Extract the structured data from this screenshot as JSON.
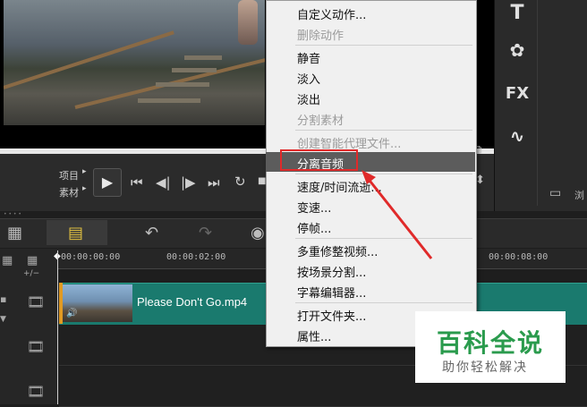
{
  "controls": {
    "project_label": "项目",
    "clip_label": "素材"
  },
  "timeline": {
    "timecodes": [
      "00:00:00:00",
      "00:00:02:00",
      "00:00:08:00"
    ],
    "clip_name": "Please Don't Go.mp4",
    "scale_toggle": "+/−"
  },
  "right_panel": {
    "fx_label": "FX",
    "browse_label": "浏"
  },
  "context_menu": {
    "items": [
      {
        "label": "自定义动作...",
        "enabled": true
      },
      {
        "label": "删除动作",
        "enabled": false
      },
      {
        "label": "静音",
        "enabled": true
      },
      {
        "label": "淡入",
        "enabled": true
      },
      {
        "label": "淡出",
        "enabled": true
      },
      {
        "label": "分割素材",
        "enabled": false
      },
      {
        "label": "创建智能代理文件...",
        "enabled": false
      },
      {
        "label": "分离音频",
        "enabled": true,
        "highlighted": true
      },
      {
        "label": "速度/时间流逝...",
        "enabled": true
      },
      {
        "label": "变速...",
        "enabled": true
      },
      {
        "label": "停帧...",
        "enabled": true
      },
      {
        "label": "多重修整视频...",
        "enabled": true
      },
      {
        "label": "按场景分割...",
        "enabled": true
      },
      {
        "label": "字幕编辑器...",
        "enabled": true
      },
      {
        "label": "打开文件夹...",
        "enabled": true
      },
      {
        "label": "属性...",
        "enabled": true
      }
    ]
  },
  "watermark": {
    "title": "百科全说",
    "subtitle": "助你轻松解决"
  },
  "colors": {
    "clip": "#1a7a6e",
    "highlight": "#5c5c5c",
    "annotation": "#e02a2a",
    "watermark_green": "#2a9b4d"
  }
}
